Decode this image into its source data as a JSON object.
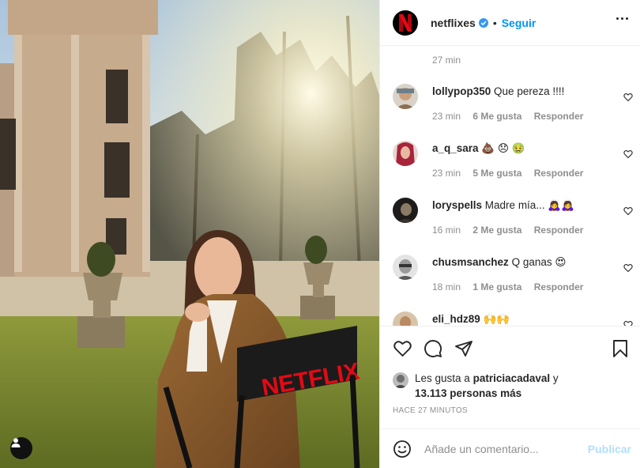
{
  "post": {
    "author": "netflixes",
    "follow_label": "Seguir",
    "separator": "•",
    "top_time": "27 min",
    "photo_text": "NETFLIX"
  },
  "comments": [
    {
      "user": "lollypop350",
      "text": "Que pereza !!!!",
      "time": "23 min",
      "likes": "6 Me gusta",
      "reply": "Responder"
    },
    {
      "user": "a_q_sara",
      "text": "💩 😞 🤢",
      "time": "23 min",
      "likes": "5 Me gusta",
      "reply": "Responder"
    },
    {
      "user": "loryspells",
      "text": "Madre mía... 🙇‍♀️🙇‍♀️",
      "time": "16 min",
      "likes": "2 Me gusta",
      "reply": "Responder"
    },
    {
      "user": "chusmsanchez",
      "text": "Q ganas 😍",
      "time": "18 min",
      "likes": "1 Me gusta",
      "reply": "Responder"
    },
    {
      "user": "eli_hdz89",
      "text": "🙌🙌",
      "time": "",
      "likes": "",
      "reply": ""
    }
  ],
  "likes": {
    "prefix": "Les gusta a",
    "user": "patriciacadaval",
    "connector": "y",
    "count": "13.113 personas más"
  },
  "timeago": "HACE 27 MINUTOS",
  "add_comment": {
    "placeholder": "Añade un comentario...",
    "publish_label": "Publicar"
  },
  "colors": {
    "accent": "#0095f6",
    "netflix_red": "#e50914",
    "verified": "#3897f0"
  }
}
